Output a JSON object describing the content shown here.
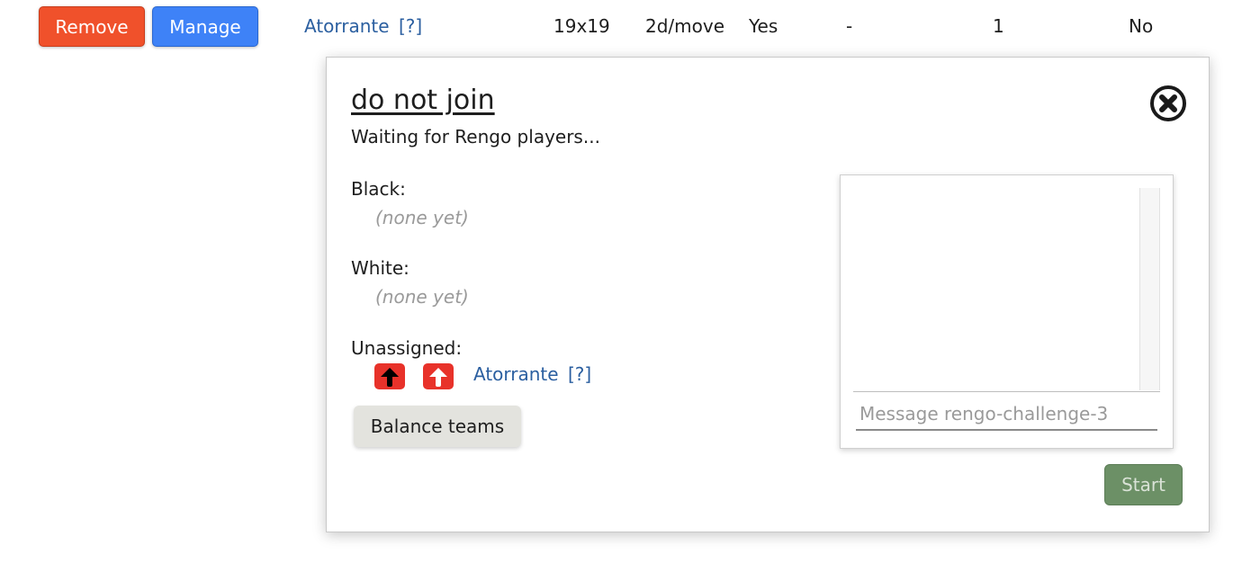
{
  "challenge_row": {
    "remove_label": "Remove",
    "manage_label": "Manage",
    "player": "Atorrante",
    "player_info": "[?]",
    "board_size": "19x19",
    "time_control": "2d/move",
    "ranked": "Yes",
    "handicap": "-",
    "rengo_count": "1",
    "last_col": "No"
  },
  "modal": {
    "title": "do not join",
    "status": "Waiting for Rengo players...",
    "close_icon": "circle-x-icon",
    "black_label": "Black:",
    "black_empty": "(none yet)",
    "white_label": "White:",
    "white_empty": "(none yet)",
    "unassigned_label": "Unassigned:",
    "unassigned": [
      {
        "name": "Atorrante",
        "info": "[?]",
        "icons": [
          "assign-black-arrow-icon",
          "assign-white-arrow-icon"
        ]
      }
    ],
    "balance_label": "Balance teams",
    "chat_placeholder": "Message rengo-challenge-3",
    "start_label": "Start"
  },
  "colors": {
    "remove": "#f0512b",
    "manage": "#3e82f7",
    "link": "#2b5fa0",
    "arrow_bg": "#e8322a",
    "start": "#6c9066",
    "balance": "#e3e3de"
  }
}
